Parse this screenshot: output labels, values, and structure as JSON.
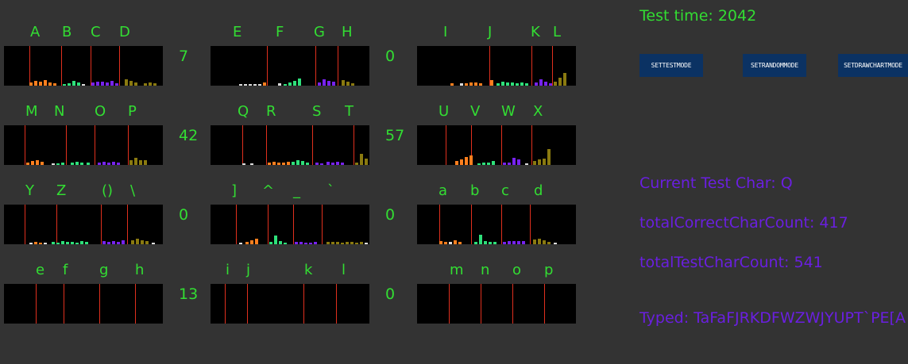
{
  "test_time_label": "Test time: 2042",
  "buttons": {
    "test_mode": "SETTESTMODE",
    "random_mode": "SETRANDOMMODE",
    "draw_chart_mode": "SETDRAWCHARTMODE"
  },
  "status": {
    "current_test_char": "Current Test Char: Q",
    "total_correct": "totalCorrectCharCount: 417",
    "total_test": "totalTestCharCount: 541",
    "typed": "Typed: TaFaFJRKDFWZWJYUPT`PE[A"
  },
  "colors": {
    "background": "#333333",
    "text_green": "#33dd33",
    "text_purple": "#6a1fe0",
    "separator_red": "#e0301e",
    "button_bg": "#0b3263",
    "bar_orange": "#ff7f1e",
    "bar_green": "#2ee07a",
    "bar_purple": "#7722ee",
    "bar_olive": "#8a7a10",
    "bar_white": "#dddddd"
  },
  "rows": [
    {
      "groups": [
        {
          "letters": [
            "A",
            "B",
            "C",
            "D"
          ],
          "count": "7"
        },
        {
          "letters": [
            "E",
            "F",
            "G",
            "H"
          ],
          "count": "0"
        },
        {
          "letters": [
            "I",
            "J",
            "K",
            "L"
          ],
          "count": ""
        }
      ]
    },
    {
      "groups": [
        {
          "letters": [
            "M",
            "N",
            "O",
            "P"
          ],
          "count": "42"
        },
        {
          "letters": [
            "Q",
            "R",
            "S",
            "T"
          ],
          "count": "57"
        },
        {
          "letters": [
            "U",
            "V",
            "W",
            "X"
          ],
          "count": ""
        }
      ]
    },
    {
      "groups": [
        {
          "letters": [
            "Y",
            "Z",
            "()",
            "\\"
          ],
          "count": "0"
        },
        {
          "letters": [
            "]",
            "^",
            "_",
            "`"
          ],
          "count": "0"
        },
        {
          "letters": [
            "a",
            "b",
            "c",
            "d"
          ],
          "count": ""
        }
      ]
    },
    {
      "groups": [
        {
          "letters": [
            "e",
            "f",
            "g",
            "h"
          ],
          "count": "13"
        },
        {
          "letters": [
            "i",
            "j",
            "k",
            "l"
          ],
          "count": "0"
        },
        {
          "letters": [
            "m",
            "n",
            "o",
            "p"
          ],
          "count": ""
        }
      ]
    }
  ]
}
